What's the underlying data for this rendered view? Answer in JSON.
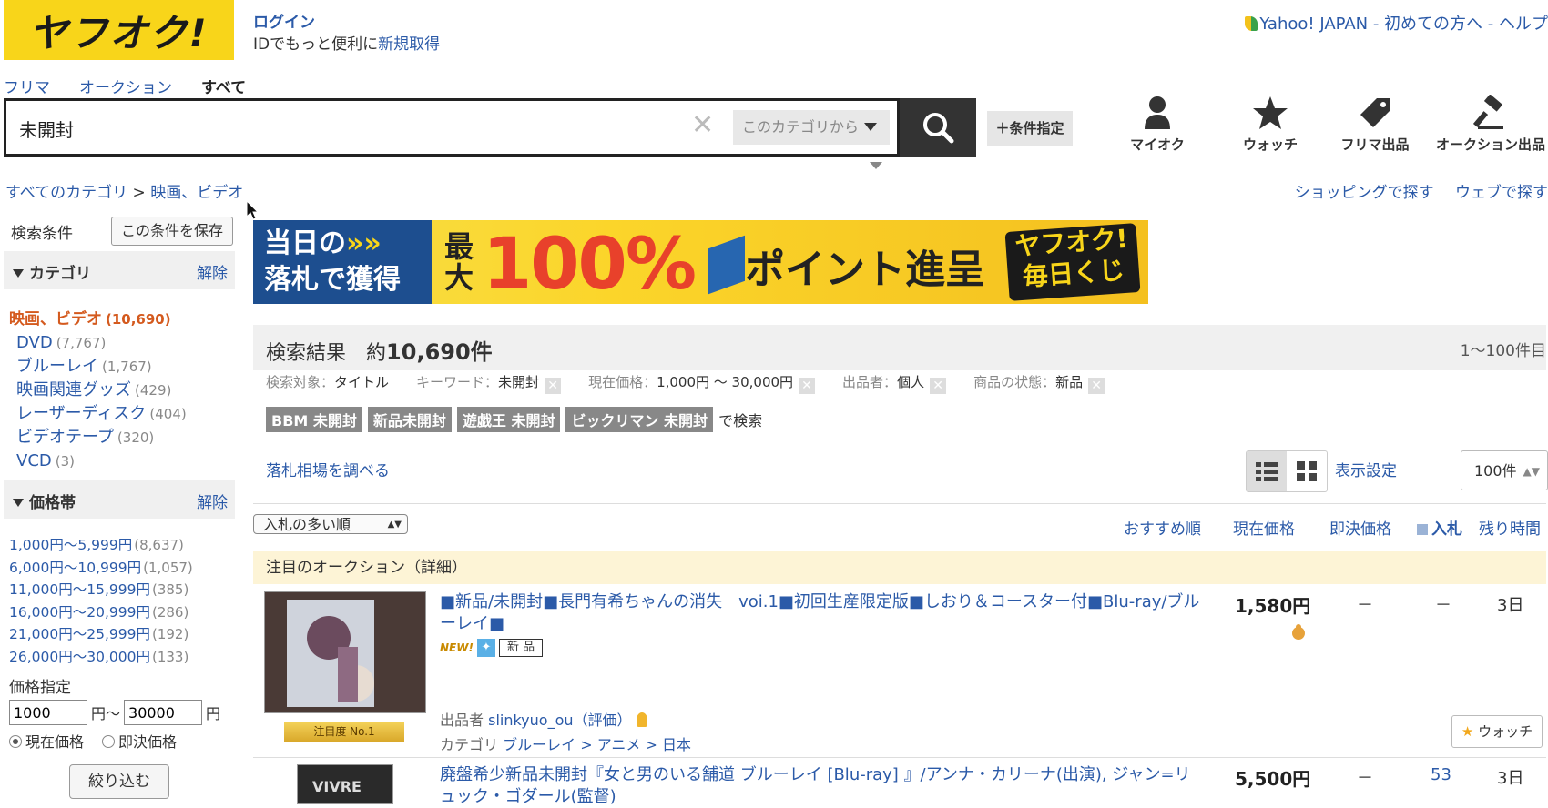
{
  "header": {
    "logo": "ヤフオク!",
    "login": "ログイン",
    "id_prefix": "IDでもっと便利に",
    "id_link": "新規取得",
    "top_right": "Yahoo! JAPAN - 初めての方へ - ヘルプ"
  },
  "tabs": [
    {
      "label": "フリマ"
    },
    {
      "label": "オークション"
    },
    {
      "label": "すべて"
    }
  ],
  "search": {
    "value": "未開封",
    "clear": "✕",
    "category_scope": "このカテゴリから",
    "condition_button": "＋条件指定"
  },
  "header_icons": {
    "myauction": "マイオク",
    "watch": "ウォッチ",
    "flea_list": "フリマ出品",
    "auction_list": "オークション出品"
  },
  "breadcrumb": {
    "root": "すべてのカテゴリ",
    "sep": ">",
    "current": "映画、ビデオ"
  },
  "right_links": {
    "shopping": "ショッピングで探す",
    "web": "ウェブで探す"
  },
  "sidebar": {
    "conditions_label": "検索条件",
    "save_button": "この条件を保存",
    "category_title": "カテゴリ",
    "clear": "解除",
    "current_category": "映画、ビデオ",
    "current_count": "(10,690)",
    "categories": [
      {
        "name": "DVD",
        "count": "(7,767)"
      },
      {
        "name": "ブルーレイ",
        "count": "(1,767)"
      },
      {
        "name": "映画関連グッズ",
        "count": "(429)"
      },
      {
        "name": "レーザーディスク",
        "count": "(404)"
      },
      {
        "name": "ビデオテープ",
        "count": "(320)"
      },
      {
        "name": "VCD",
        "count": "(3)"
      }
    ],
    "price_title": "価格帯",
    "prices": [
      {
        "range": "1,000円～5,999円",
        "count": "(8,637)"
      },
      {
        "range": "6,000円～10,999円",
        "count": "(1,057)"
      },
      {
        "range": "11,000円～15,999円",
        "count": "(385)"
      },
      {
        "range": "16,000円～20,999円",
        "count": "(286)"
      },
      {
        "range": "21,000円～25,999円",
        "count": "(192)"
      },
      {
        "range": "26,000円～30,000円",
        "count": "(133)"
      }
    ],
    "price_spec": "価格指定",
    "price_min": "1000",
    "price_from_unit": "円～",
    "price_max": "30000",
    "price_to_unit": "円",
    "radio_current": "現在価格",
    "radio_buynow": "即決価格",
    "narrow_button": "絞り込む"
  },
  "banner": {
    "left_line1": "当日の",
    "left_arrows": "»»",
    "left_line2": "落札で獲得",
    "max": "最大",
    "percent": "100%",
    "points": "ポイント進呈",
    "badge_line1": "ヤフオク!",
    "badge_line2": "毎日くじ"
  },
  "results": {
    "label": "検索結果",
    "count_prefix": "約",
    "count": "10,690件",
    "range": "1～100件目",
    "filters": [
      {
        "key": "検索対象：",
        "value": "タイトル",
        "removable": false
      },
      {
        "key": "キーワード：",
        "value": "未開封",
        "removable": true
      },
      {
        "key": "現在価格：",
        "value": "1,000円 ～ 30,000円",
        "removable": true
      },
      {
        "key": "出品者：",
        "value": "個人",
        "removable": true
      },
      {
        "key": "商品の状態：",
        "value": "新品",
        "removable": true
      }
    ],
    "related_tags": [
      "BBM 未開封",
      "新品未開封",
      "遊戯王 未開封",
      "ビックリマン 未開封"
    ],
    "related_suffix": "で検索",
    "market_link": "落札相場を調べる",
    "display_settings": "表示設定",
    "per_page": "100件",
    "sort": "入札の多い順",
    "columns": {
      "recommended": "おすすめ順",
      "current_price": "現在価格",
      "buynow_price": "即決価格",
      "bids": "入札",
      "time_left": "残り時間"
    },
    "featured_label": "注目のオークション（詳細）"
  },
  "items": [
    {
      "title": "■新品/未開封■長門有希ちゃんの消失　voi.1■初回生産限定版■しおり＆コースター付■Blu-ray/ブルーレイ■",
      "new_badge": "NEW!",
      "condition": "新 品",
      "price": "1,580円",
      "buynow": "－",
      "bids": "－",
      "time_left": "3日",
      "seller_label": "出品者",
      "seller": "slinkyuo_ou",
      "rating": "（評価）",
      "category_label": "カテゴリ",
      "category_path": [
        "ブルーレイ",
        "アニメ",
        "日本"
      ],
      "rank": "注目度 No.1",
      "watch": "ウォッチ"
    },
    {
      "title": "廃盤希少新品未開封『女と男のいる舗道 ブルーレイ [Blu-ray] 』/アンナ・カリーナ(出演), ジャン=リュック・ゴダール(監督)",
      "price": "5,500円",
      "buynow": "－",
      "bids": "53",
      "time_left": "3日",
      "thumb_text": "VIVRE"
    }
  ]
}
